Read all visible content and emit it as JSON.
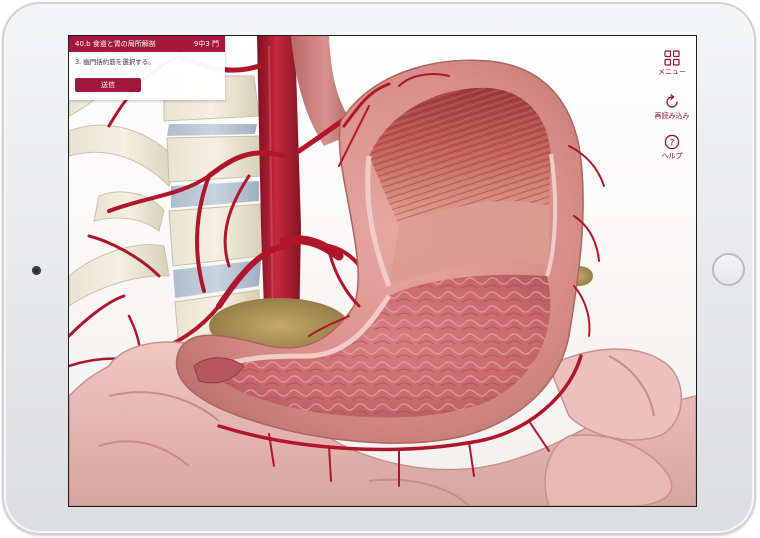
{
  "quiz": {
    "title": "40.b 食道と胃の局所解剖",
    "progress": "9中3 門",
    "question": "3. 幽門括約筋を選択する。",
    "submit_label": "送信"
  },
  "toolbar": {
    "menu_label": "メニュー",
    "reload_label": "再読み込み",
    "help_label": "ヘルプ"
  },
  "icons": {
    "menu": "grid-icon",
    "reload": "refresh-icon",
    "help": "question-circle-icon"
  },
  "colors": {
    "accent": "#a2173b",
    "device_frame": "#e9eaec",
    "artery": "#b0162a",
    "stomach": "#d48a86"
  }
}
